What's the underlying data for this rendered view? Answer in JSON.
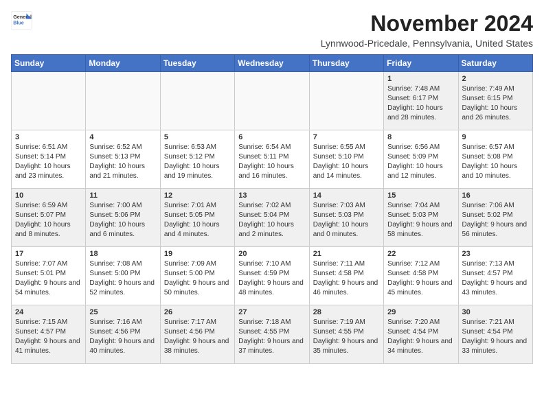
{
  "logo": {
    "line1": "General",
    "line2": "Blue"
  },
  "title": "November 2024",
  "location": "Lynnwood-Pricedale, Pennsylvania, United States",
  "days_of_week": [
    "Sunday",
    "Monday",
    "Tuesday",
    "Wednesday",
    "Thursday",
    "Friday",
    "Saturday"
  ],
  "weeks": [
    [
      {
        "day": "",
        "info": ""
      },
      {
        "day": "",
        "info": ""
      },
      {
        "day": "",
        "info": ""
      },
      {
        "day": "",
        "info": ""
      },
      {
        "day": "",
        "info": ""
      },
      {
        "day": "1",
        "info": "Sunrise: 7:48 AM\nSunset: 6:17 PM\nDaylight: 10 hours and 28 minutes."
      },
      {
        "day": "2",
        "info": "Sunrise: 7:49 AM\nSunset: 6:15 PM\nDaylight: 10 hours and 26 minutes."
      }
    ],
    [
      {
        "day": "3",
        "info": "Sunrise: 6:51 AM\nSunset: 5:14 PM\nDaylight: 10 hours and 23 minutes."
      },
      {
        "day": "4",
        "info": "Sunrise: 6:52 AM\nSunset: 5:13 PM\nDaylight: 10 hours and 21 minutes."
      },
      {
        "day": "5",
        "info": "Sunrise: 6:53 AM\nSunset: 5:12 PM\nDaylight: 10 hours and 19 minutes."
      },
      {
        "day": "6",
        "info": "Sunrise: 6:54 AM\nSunset: 5:11 PM\nDaylight: 10 hours and 16 minutes."
      },
      {
        "day": "7",
        "info": "Sunrise: 6:55 AM\nSunset: 5:10 PM\nDaylight: 10 hours and 14 minutes."
      },
      {
        "day": "8",
        "info": "Sunrise: 6:56 AM\nSunset: 5:09 PM\nDaylight: 10 hours and 12 minutes."
      },
      {
        "day": "9",
        "info": "Sunrise: 6:57 AM\nSunset: 5:08 PM\nDaylight: 10 hours and 10 minutes."
      }
    ],
    [
      {
        "day": "10",
        "info": "Sunrise: 6:59 AM\nSunset: 5:07 PM\nDaylight: 10 hours and 8 minutes."
      },
      {
        "day": "11",
        "info": "Sunrise: 7:00 AM\nSunset: 5:06 PM\nDaylight: 10 hours and 6 minutes."
      },
      {
        "day": "12",
        "info": "Sunrise: 7:01 AM\nSunset: 5:05 PM\nDaylight: 10 hours and 4 minutes."
      },
      {
        "day": "13",
        "info": "Sunrise: 7:02 AM\nSunset: 5:04 PM\nDaylight: 10 hours and 2 minutes."
      },
      {
        "day": "14",
        "info": "Sunrise: 7:03 AM\nSunset: 5:03 PM\nDaylight: 10 hours and 0 minutes."
      },
      {
        "day": "15",
        "info": "Sunrise: 7:04 AM\nSunset: 5:03 PM\nDaylight: 9 hours and 58 minutes."
      },
      {
        "day": "16",
        "info": "Sunrise: 7:06 AM\nSunset: 5:02 PM\nDaylight: 9 hours and 56 minutes."
      }
    ],
    [
      {
        "day": "17",
        "info": "Sunrise: 7:07 AM\nSunset: 5:01 PM\nDaylight: 9 hours and 54 minutes."
      },
      {
        "day": "18",
        "info": "Sunrise: 7:08 AM\nSunset: 5:00 PM\nDaylight: 9 hours and 52 minutes."
      },
      {
        "day": "19",
        "info": "Sunrise: 7:09 AM\nSunset: 5:00 PM\nDaylight: 9 hours and 50 minutes."
      },
      {
        "day": "20",
        "info": "Sunrise: 7:10 AM\nSunset: 4:59 PM\nDaylight: 9 hours and 48 minutes."
      },
      {
        "day": "21",
        "info": "Sunrise: 7:11 AM\nSunset: 4:58 PM\nDaylight: 9 hours and 46 minutes."
      },
      {
        "day": "22",
        "info": "Sunrise: 7:12 AM\nSunset: 4:58 PM\nDaylight: 9 hours and 45 minutes."
      },
      {
        "day": "23",
        "info": "Sunrise: 7:13 AM\nSunset: 4:57 PM\nDaylight: 9 hours and 43 minutes."
      }
    ],
    [
      {
        "day": "24",
        "info": "Sunrise: 7:15 AM\nSunset: 4:57 PM\nDaylight: 9 hours and 41 minutes."
      },
      {
        "day": "25",
        "info": "Sunrise: 7:16 AM\nSunset: 4:56 PM\nDaylight: 9 hours and 40 minutes."
      },
      {
        "day": "26",
        "info": "Sunrise: 7:17 AM\nSunset: 4:56 PM\nDaylight: 9 hours and 38 minutes."
      },
      {
        "day": "27",
        "info": "Sunrise: 7:18 AM\nSunset: 4:55 PM\nDaylight: 9 hours and 37 minutes."
      },
      {
        "day": "28",
        "info": "Sunrise: 7:19 AM\nSunset: 4:55 PM\nDaylight: 9 hours and 35 minutes."
      },
      {
        "day": "29",
        "info": "Sunrise: 7:20 AM\nSunset: 4:54 PM\nDaylight: 9 hours and 34 minutes."
      },
      {
        "day": "30",
        "info": "Sunrise: 7:21 AM\nSunset: 4:54 PM\nDaylight: 9 hours and 33 minutes."
      }
    ]
  ]
}
